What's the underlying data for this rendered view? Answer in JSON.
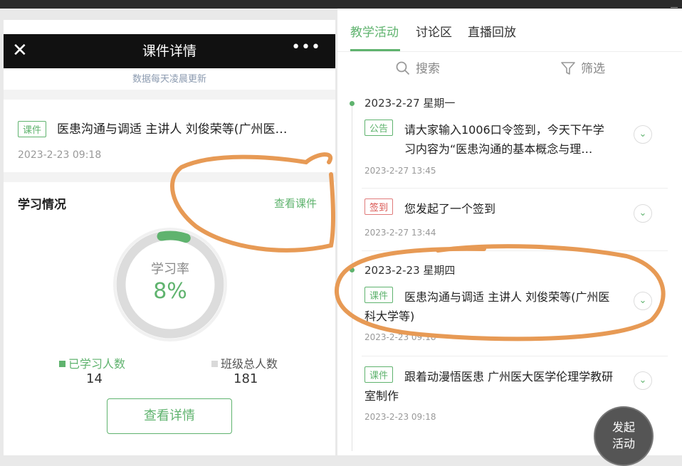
{
  "left": {
    "header": {
      "close_icon": "close-icon",
      "title": "课件详情",
      "more_icon": "more-icon",
      "more": "•••"
    },
    "notice": "数据每天凌晨更新",
    "courseware": {
      "tag": "课件",
      "title": "医患沟通与调适 主讲人 刘俊荣等(广州医…",
      "date": "2023-2-23 09:18"
    },
    "study": {
      "title": "学习情况",
      "view_course": "查看课件",
      "rate_label": "学习率",
      "rate_value": "8%",
      "rate_fraction": 0.08,
      "learned_label": "已学习人数",
      "learned_count": "14",
      "total_label": "班级总人数",
      "total_count": "181",
      "detail_button": "查看详情"
    }
  },
  "right": {
    "tabs": [
      {
        "label": "教学活动",
        "active": true
      },
      {
        "label": "讨论区",
        "active": false
      },
      {
        "label": "直播回放",
        "active": false
      }
    ],
    "search_label": "搜索",
    "filter_label": "筛选",
    "feed": [
      {
        "date_head": "2023-2-27 星期一",
        "tag": "公告",
        "text": "请大家输入1006口令签到，今天下午学习内容为“医患沟通的基本概念与理…",
        "time": "2023-2-27 13:45"
      },
      {
        "tag": "签到",
        "text": "您发起了一个签到",
        "time": "2023-2-27 13:44"
      },
      {
        "date_head": "2023-2-23 星期四",
        "tag": "课件",
        "text": "医患沟通与调适 主讲人 刘俊荣等(广州医科大学等)",
        "time": "2023-2-23 09:18"
      },
      {
        "tag": "课件",
        "text": "跟着动漫悟医患 广州医大医学伦理学教研室制作",
        "time": "2023-2-23 09:18"
      }
    ],
    "fab": {
      "line1": "发起",
      "line2": "活动"
    }
  },
  "colors": {
    "accent": "#5fb36e",
    "annotation": "#e79a55",
    "header_bg": "#111111",
    "tag_red": "#d9534f"
  }
}
